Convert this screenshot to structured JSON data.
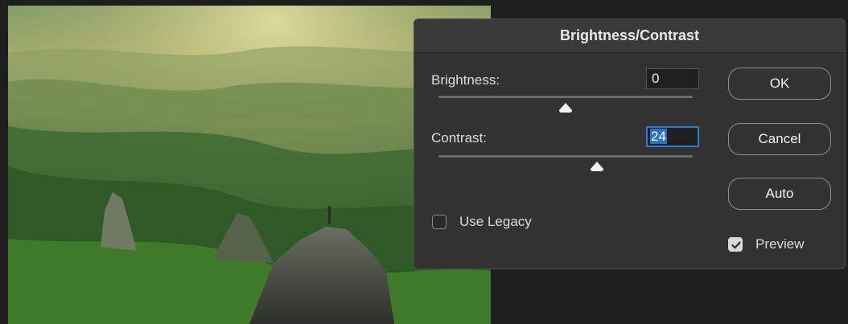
{
  "dialog": {
    "title": "Brightness/Contrast",
    "brightness": {
      "label": "Brightness:",
      "value": "0"
    },
    "contrast": {
      "label": "Contrast:",
      "value": "24"
    },
    "use_legacy": {
      "label": "Use Legacy",
      "checked": false
    },
    "preview": {
      "label": "Preview",
      "checked": true
    },
    "buttons": {
      "ok": "OK",
      "cancel": "Cancel",
      "auto": "Auto"
    }
  },
  "colors": {
    "dialog_bg": "#323232",
    "selection_accent": "#2f78d6"
  },
  "icons": {
    "preview_check": "checkmark-icon"
  }
}
